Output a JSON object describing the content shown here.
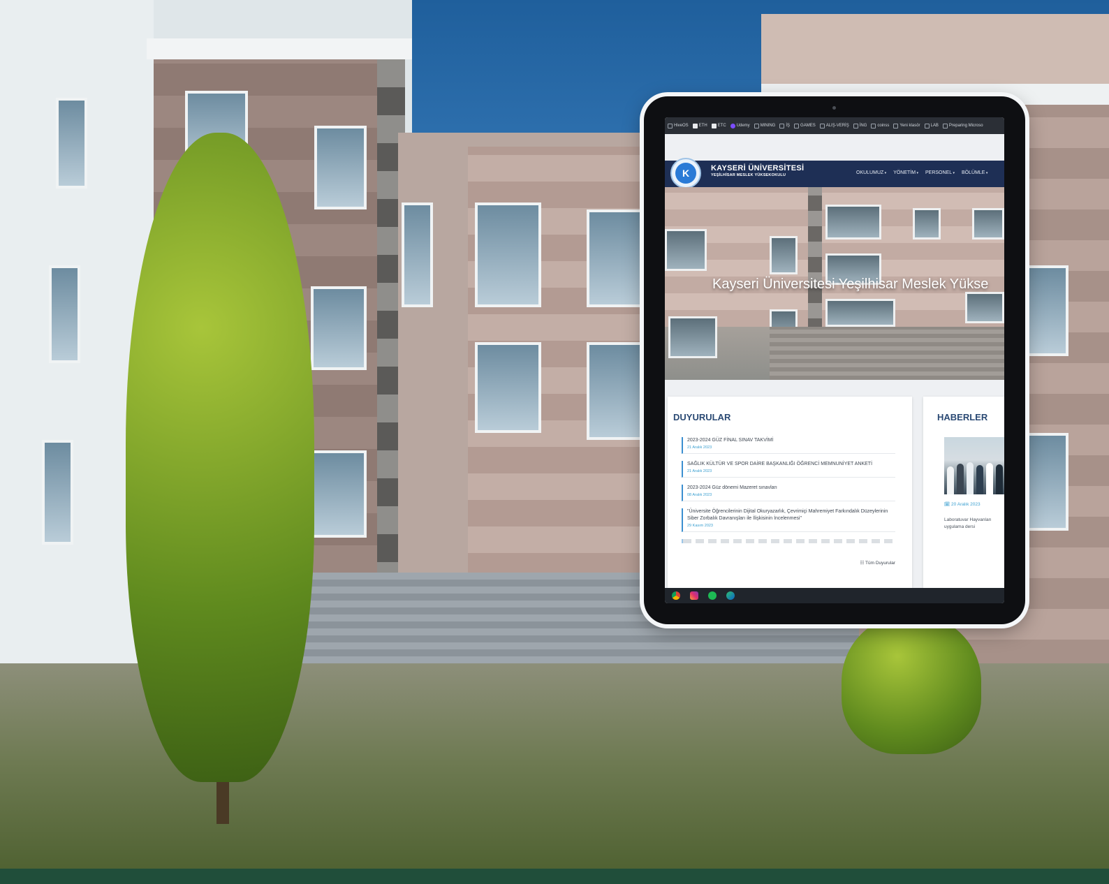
{
  "bookmarks_bar": {
    "items": [
      {
        "label": "HiveOS",
        "icon": "hiveos-icon"
      },
      {
        "label": "ETH",
        "icon": "file-icon"
      },
      {
        "label": "ETC",
        "icon": "file-icon"
      },
      {
        "label": "Udemy",
        "icon": "udemy-icon"
      },
      {
        "label": "MINING",
        "icon": "folder-icon"
      },
      {
        "label": "İŞ",
        "icon": "folder-icon"
      },
      {
        "label": "GAMES",
        "icon": "folder-icon"
      },
      {
        "label": "ALIŞ-VERİŞ",
        "icon": "folder-icon"
      },
      {
        "label": "İNG",
        "icon": "folder-icon"
      },
      {
        "label": "coinss",
        "icon": "folder-icon"
      },
      {
        "label": "Yeni klasör",
        "icon": "folder-icon"
      },
      {
        "label": "LAB",
        "icon": "folder-icon"
      },
      {
        "label": "Preparing Microso",
        "icon": "microsoft-icon"
      }
    ]
  },
  "site": {
    "logo_letter": "K",
    "brand_title": "KAYSERİ ÜNİVERSİTESİ",
    "brand_subtitle": "YEŞİLHİSAR MESLEK YÜKSEKOKULU",
    "menu": [
      "OKULUMUZ",
      "YÖNETİM",
      "PERSONEL",
      "BÖLÜMLE"
    ],
    "hero_title": "Kayseri Üniversitesi Yeşilhisar Meslek Yükse"
  },
  "announcements": {
    "heading": "DUYURULAR",
    "items": [
      {
        "title": "2023-2024 GÜZ FİNAL SINAV TAKVİMİ",
        "date": "21 Aralık 2023"
      },
      {
        "title": "SAĞLIK KÜLTÜR VE SPOR DAİRE BAŞKANLIĞI ÖĞRENCİ MEMNUNİYET ANKETİ",
        "date": "21 Aralık 2023"
      },
      {
        "title": "2023-2024 Güz dönemi Mazeret sınavları",
        "date": "08 Aralık 2023"
      },
      {
        "title": "\"Üniversite Öğrencilerinin Dijital Okuryazarlık, Çevrimiçi Mahremiyet Farkındalık Düzeylerinin Siber Zorbalık Davranışları ile İlişkisinin İncelenmesi\"",
        "date": "29 Kasım 2023"
      }
    ],
    "all_link": "☷ Tüm Duyurular"
  },
  "news": {
    "heading": "HABERLER",
    "date": "🗓 20 Aralık 2023",
    "text_line1": "Laboratuvar Hayvanları",
    "text_line2": "uygulama dersi"
  },
  "taskbar": {
    "icons": [
      "chrome-icon",
      "instagram-icon",
      "spotify-icon",
      "edge-icon"
    ]
  },
  "colors": {
    "navbar": "#1e2f55",
    "accent": "#3a9fd0",
    "heading": "#2b4a74"
  }
}
